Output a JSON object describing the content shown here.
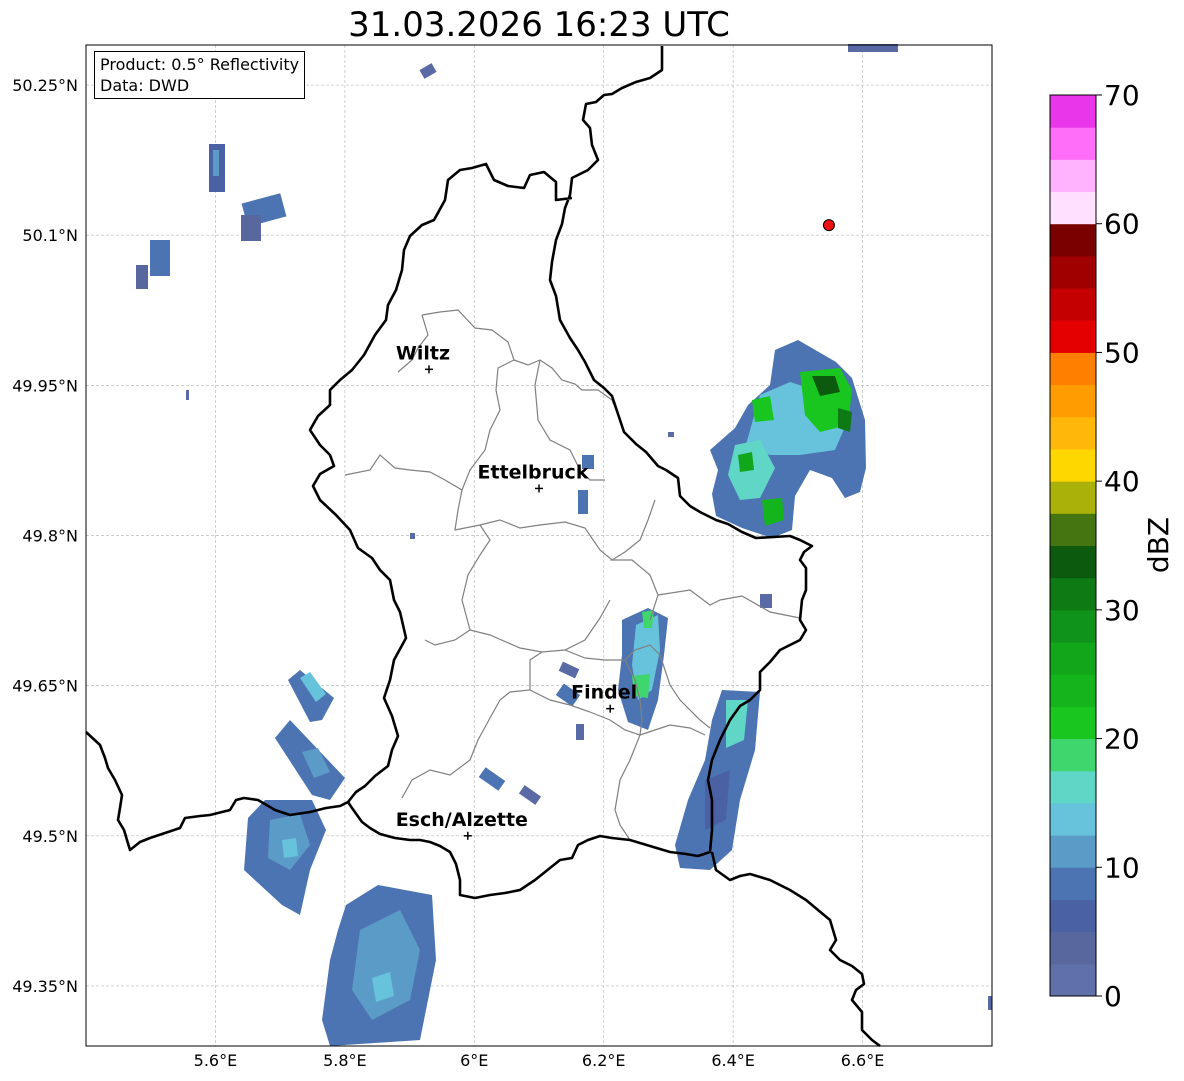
{
  "title": "31.03.2026 16:23 UTC",
  "info": {
    "product": "Product: 0.5° Reflectivity",
    "data": "Data: DWD"
  },
  "map": {
    "lon_range": [
      5.4,
      6.8
    ],
    "lat_range": [
      49.29,
      50.29
    ],
    "lon_ticks": [
      {
        "value": 5.6,
        "label": "5.6°E"
      },
      {
        "value": 5.8,
        "label": "5.8°E"
      },
      {
        "value": 6.0,
        "label": "6°E"
      },
      {
        "value": 6.2,
        "label": "6.2°E"
      },
      {
        "value": 6.4,
        "label": "6.4°E"
      },
      {
        "value": 6.6,
        "label": "6.6°E"
      }
    ],
    "lat_ticks": [
      {
        "value": 50.25,
        "label": "50.25°N"
      },
      {
        "value": 50.1,
        "label": "50.1°N"
      },
      {
        "value": 49.95,
        "label": "49.95°N"
      },
      {
        "value": 49.8,
        "label": "49.8°N"
      },
      {
        "value": 49.65,
        "label": "49.65°N"
      },
      {
        "value": 49.5,
        "label": "49.5°N"
      },
      {
        "value": 49.35,
        "label": "49.35°N"
      }
    ],
    "grid": true,
    "cities": [
      {
        "name": "Wiltz",
        "lon": 5.93,
        "lat": 49.966
      },
      {
        "name": "Ettelbruck",
        "lon": 6.1,
        "lat": 49.847
      },
      {
        "name": "Findel",
        "lon": 6.21,
        "lat": 49.627
      },
      {
        "name": "Esch/Alzette",
        "lon": 5.99,
        "lat": 49.5
      }
    ],
    "radar_site": {
      "lon": 6.548,
      "lat": 50.11,
      "color": "#ee1111"
    }
  },
  "colorbar": {
    "label": "dBZ",
    "min": 0,
    "max": 70,
    "step": 2.5,
    "ticks": [
      0,
      10,
      20,
      30,
      40,
      50,
      60,
      70
    ],
    "colors": [
      "#6070a8",
      "#58689f",
      "#4a62a4",
      "#4c74b2",
      "#5b9bc7",
      "#67c2dc",
      "#5fd6c6",
      "#3fd66e",
      "#18c61f",
      "#14b51c",
      "#12a61b",
      "#10931a",
      "#0d7a14",
      "#0b5a0d",
      "#457510",
      "#aab20a",
      "#ffd700",
      "#ffb70a",
      "#ff9d00",
      "#ff7f00",
      "#e40000",
      "#c40000",
      "#a00000",
      "#7a0000",
      "#ffe0ff",
      "#ffb3ff",
      "#ff6ef8",
      "#ea36ea"
    ]
  }
}
